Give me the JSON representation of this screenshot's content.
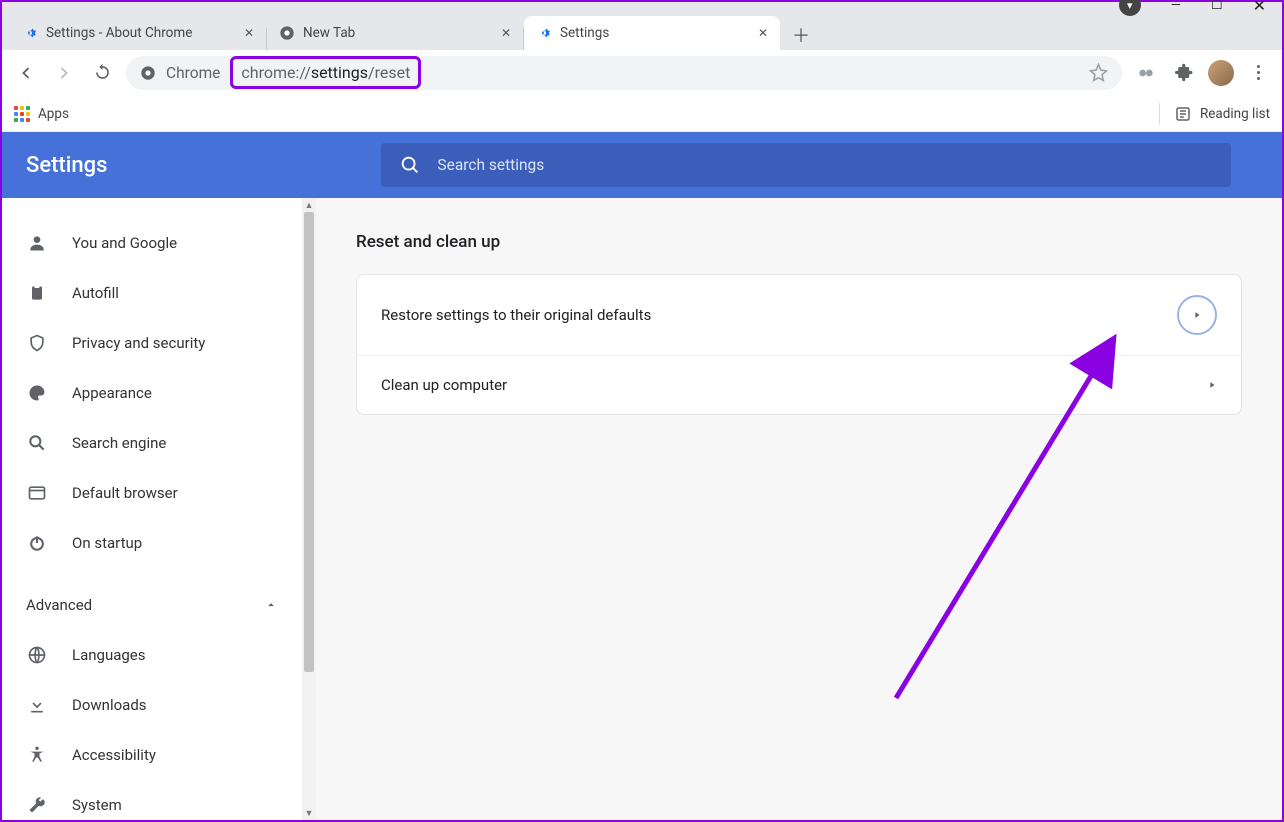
{
  "tabs": [
    {
      "title": "Settings - About Chrome"
    },
    {
      "title": "New Tab"
    },
    {
      "title": "Settings"
    }
  ],
  "addressBar": {
    "chromeLabel": "Chrome",
    "urlMutedPrefix": "chrome://",
    "urlBold": "settings",
    "urlMutedSuffix": "/reset"
  },
  "bookmarkBar": {
    "apps": "Apps",
    "readingList": "Reading list"
  },
  "header": {
    "title": "Settings",
    "searchPlaceholder": "Search settings"
  },
  "sidebar": {
    "items": [
      {
        "label": "You and Google"
      },
      {
        "label": "Autofill"
      },
      {
        "label": "Privacy and security"
      },
      {
        "label": "Appearance"
      },
      {
        "label": "Search engine"
      },
      {
        "label": "Default browser"
      },
      {
        "label": "On startup"
      }
    ],
    "advancedLabel": "Advanced",
    "advancedItems": [
      {
        "label": "Languages"
      },
      {
        "label": "Downloads"
      },
      {
        "label": "Accessibility"
      },
      {
        "label": "System"
      }
    ]
  },
  "page": {
    "heading": "Reset and clean up",
    "rows": [
      {
        "label": "Restore settings to their original defaults"
      },
      {
        "label": "Clean up computer"
      }
    ]
  }
}
